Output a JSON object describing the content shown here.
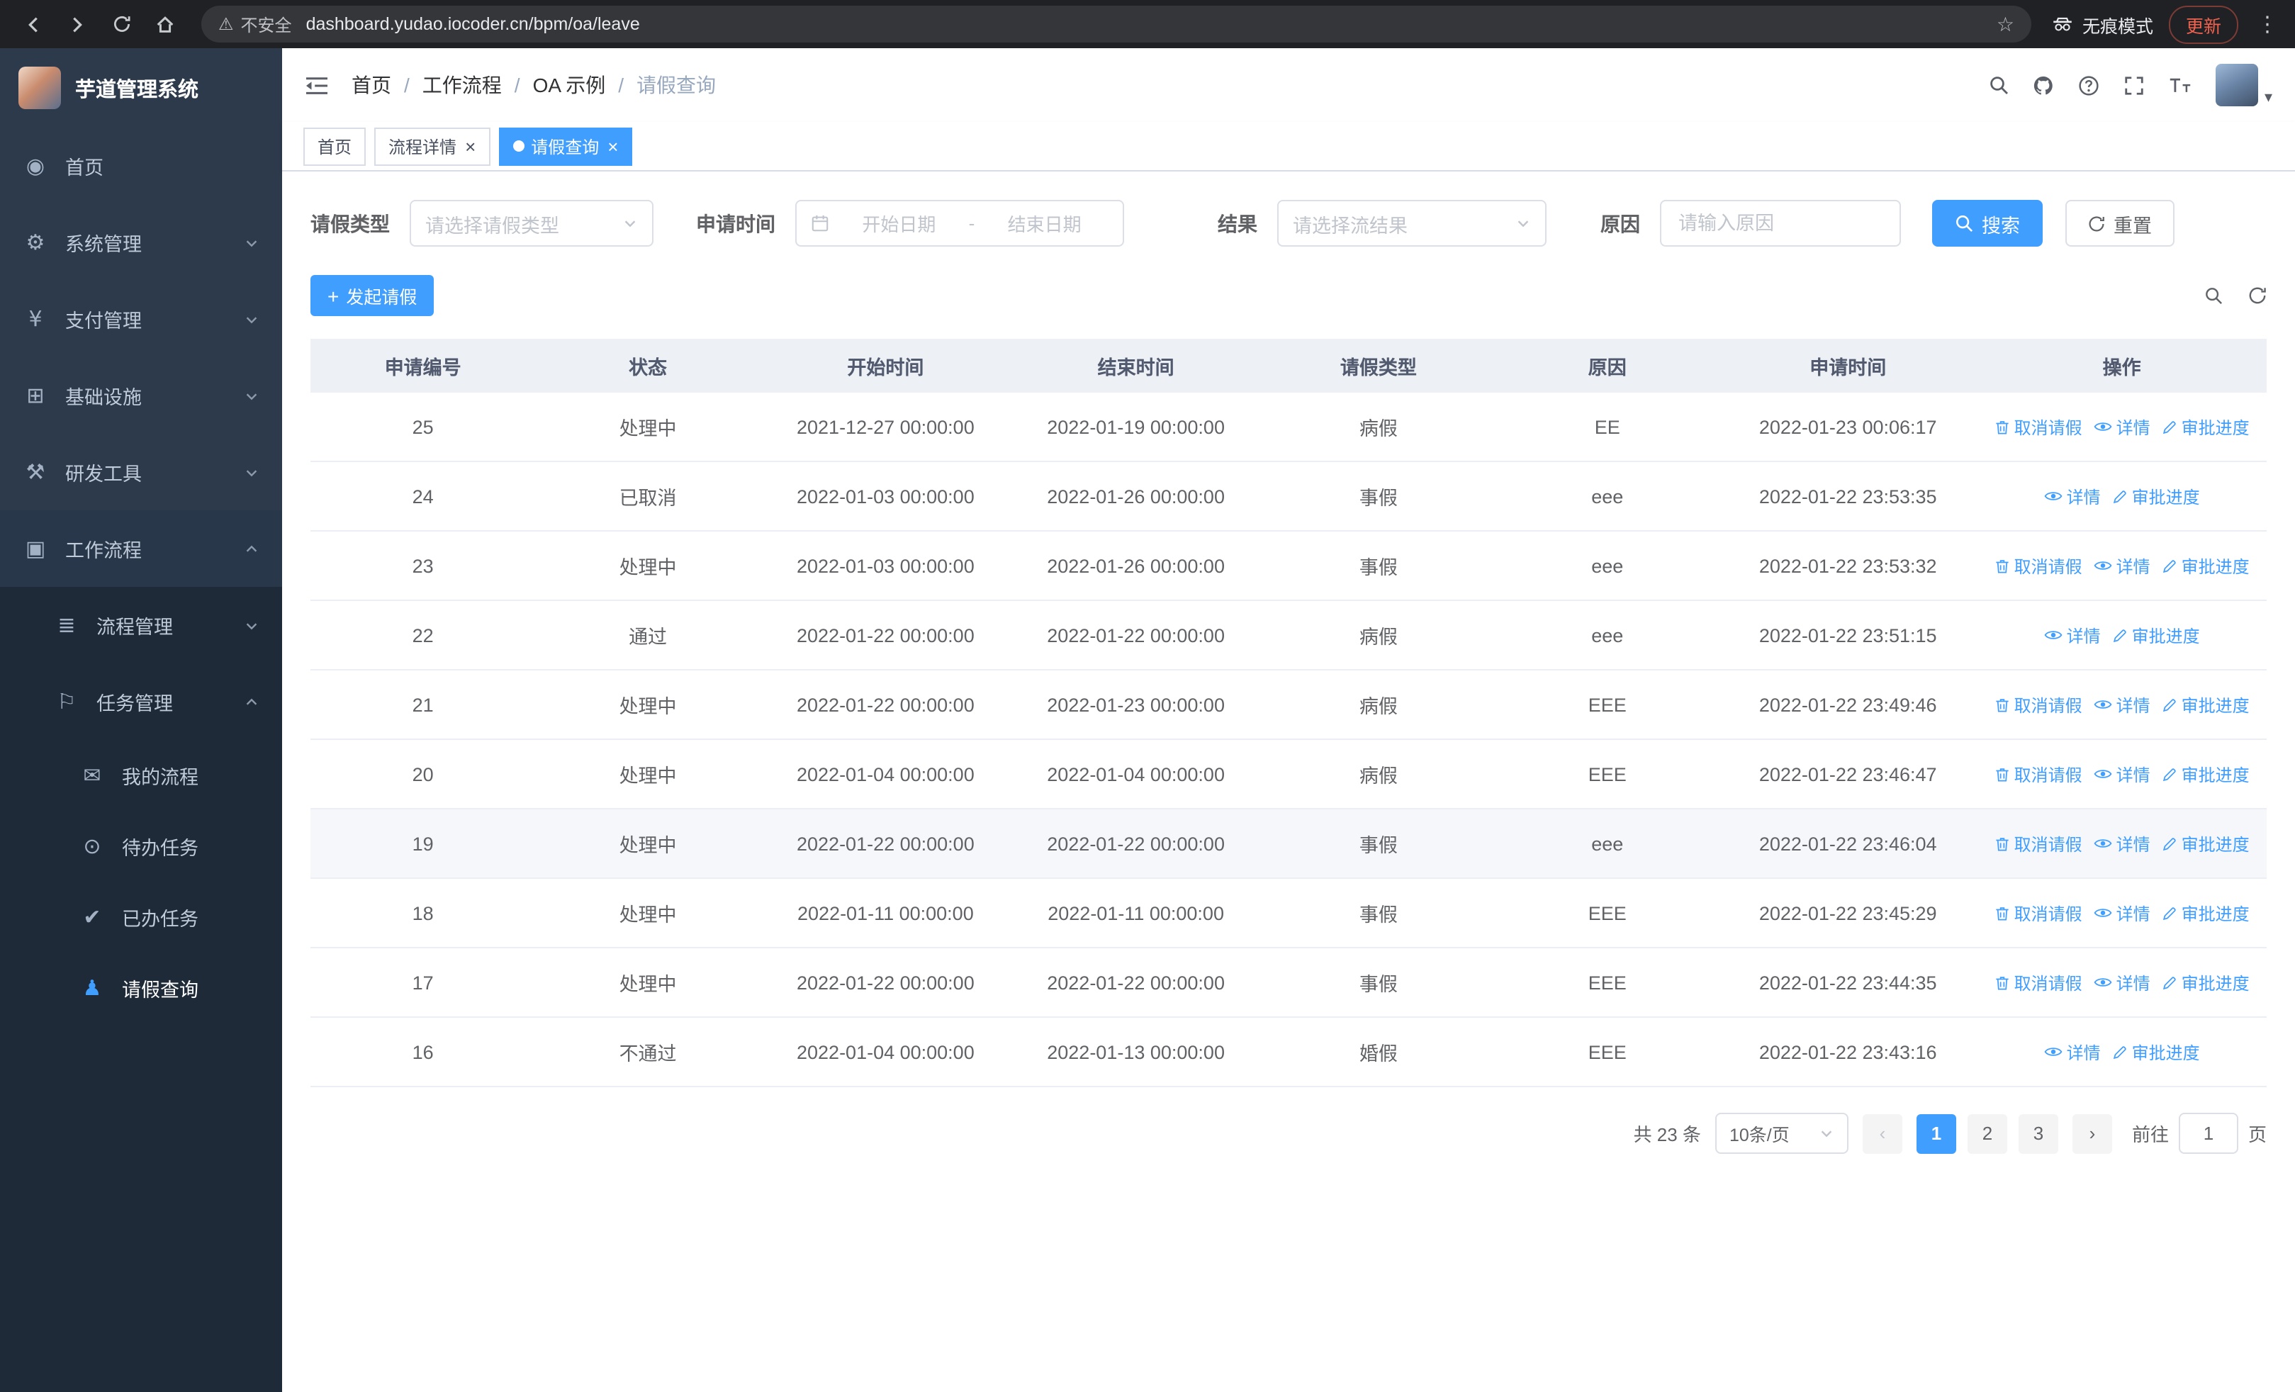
{
  "browser": {
    "security_label": "不安全",
    "url": "dashboard.yudao.iocoder.cn/bpm/oa/leave",
    "incognito_label": "无痕模式",
    "update_label": "更新"
  },
  "icons": {
    "warning_triangle": "⚠",
    "bookmark_star": "☆",
    "kebab_menu": "⋮",
    "caret_down": "▾",
    "plus": "+",
    "close": "×",
    "prev_arrow": "‹",
    "next_arrow": "›"
  },
  "colors": {
    "primary": "#409eff",
    "sidebar_bg": "#2d3a4b",
    "sidebar_sub_bg": "#1f2a38"
  },
  "sidebar": {
    "app_title": "芋道管理系统",
    "items": [
      {
        "label": "首页",
        "icon": "dashboard-icon",
        "glyph": "◉",
        "level": 1
      },
      {
        "label": "系统管理",
        "icon": "gear-icon",
        "glyph": "⚙",
        "level": 1,
        "expandable": true,
        "state": "collapsed"
      },
      {
        "label": "支付管理",
        "icon": "payment-icon",
        "glyph": "¥",
        "level": 1,
        "expandable": true,
        "state": "collapsed"
      },
      {
        "label": "基础设施",
        "icon": "infrastructure-icon",
        "glyph": "⊞",
        "level": 1,
        "expandable": true,
        "state": "collapsed"
      },
      {
        "label": "研发工具",
        "icon": "devtools-icon",
        "glyph": "⚒",
        "level": 1,
        "expandable": true,
        "state": "collapsed"
      },
      {
        "label": "工作流程",
        "icon": "workflow-icon",
        "glyph": "▣",
        "level": 1,
        "expandable": true,
        "state": "expanded",
        "hover": true
      },
      {
        "label": "流程管理",
        "icon": "process-management-icon",
        "glyph": "≣",
        "level": 2,
        "expandable": true,
        "state": "collapsed"
      },
      {
        "label": "任务管理",
        "icon": "task-management-icon",
        "glyph": "⚐",
        "level": 2,
        "expandable": true,
        "state": "expanded"
      },
      {
        "label": "我的流程",
        "icon": "my-process-icon",
        "glyph": "✉",
        "level": 3
      },
      {
        "label": "待办任务",
        "icon": "todo-task-icon",
        "glyph": "⊙",
        "level": 3
      },
      {
        "label": "已办任务",
        "icon": "done-task-icon",
        "glyph": "✔",
        "level": 3
      },
      {
        "label": "请假查询",
        "icon": "leave-query-icon",
        "glyph": "♟",
        "level": 3,
        "active": true
      }
    ]
  },
  "navbar": {
    "separator": "/",
    "breadcrumb": [
      {
        "label": "首页"
      },
      {
        "label": "工作流程",
        "sep": true
      },
      {
        "label": "OA 示例",
        "sep": true
      },
      {
        "label": "请假查询",
        "sep": true,
        "last": true
      }
    ]
  },
  "tabs": [
    {
      "label": "首页"
    },
    {
      "label": "流程详情",
      "closable": true
    },
    {
      "label": "请假查询",
      "closable": true,
      "active": true
    }
  ],
  "filters": {
    "leave_type_label": "请假类型",
    "leave_type_placeholder": "请选择请假类型",
    "apply_time_label": "申请时间",
    "start_placeholder": "开始日期",
    "range_separator": "-",
    "end_placeholder": "结束日期",
    "result_label": "结果",
    "result_placeholder": "请选择流结果",
    "reason_label": "原因",
    "reason_placeholder": "请输入原因",
    "search_label": "搜索",
    "reset_label": "重置"
  },
  "toolbar": {
    "create_label": "发起请假"
  },
  "table": {
    "columns": [
      {
        "key": "id",
        "label": "申请编号"
      },
      {
        "key": "status",
        "label": "状态"
      },
      {
        "key": "start",
        "label": "开始时间"
      },
      {
        "key": "end",
        "label": "结束时间"
      },
      {
        "key": "type",
        "label": "请假类型"
      },
      {
        "key": "reason",
        "label": "原因"
      },
      {
        "key": "apply",
        "label": "申请时间"
      },
      {
        "key": "actions",
        "label": "操作"
      }
    ],
    "action_labels": {
      "cancel": "取消请假",
      "detail": "详情",
      "progress": "审批进度"
    },
    "rows": [
      {
        "id": "25",
        "status": "处理中",
        "start": "2021-12-27 00:00:00",
        "end": "2022-01-19 00:00:00",
        "type": "病假",
        "reason": "EE",
        "apply": "2022-01-23 00:06:17",
        "can_cancel": true
      },
      {
        "id": "24",
        "status": "已取消",
        "start": "2022-01-03 00:00:00",
        "end": "2022-01-26 00:00:00",
        "type": "事假",
        "reason": "eee",
        "apply": "2022-01-22 23:53:35"
      },
      {
        "id": "23",
        "status": "处理中",
        "start": "2022-01-03 00:00:00",
        "end": "2022-01-26 00:00:00",
        "type": "事假",
        "reason": "eee",
        "apply": "2022-01-22 23:53:32",
        "can_cancel": true
      },
      {
        "id": "22",
        "status": "通过",
        "start": "2022-01-22 00:00:00",
        "end": "2022-01-22 00:00:00",
        "type": "病假",
        "reason": "eee",
        "apply": "2022-01-22 23:51:15"
      },
      {
        "id": "21",
        "status": "处理中",
        "start": "2022-01-22 00:00:00",
        "end": "2022-01-23 00:00:00",
        "type": "病假",
        "reason": "EEE",
        "apply": "2022-01-22 23:49:46",
        "can_cancel": true
      },
      {
        "id": "20",
        "status": "处理中",
        "start": "2022-01-04 00:00:00",
        "end": "2022-01-04 00:00:00",
        "type": "病假",
        "reason": "EEE",
        "apply": "2022-01-22 23:46:47",
        "can_cancel": true
      },
      {
        "id": "19",
        "status": "处理中",
        "start": "2022-01-22 00:00:00",
        "end": "2022-01-22 00:00:00",
        "type": "事假",
        "reason": "eee",
        "apply": "2022-01-22 23:46:04",
        "can_cancel": true,
        "highlight": true
      },
      {
        "id": "18",
        "status": "处理中",
        "start": "2022-01-11 00:00:00",
        "end": "2022-01-11 00:00:00",
        "type": "事假",
        "reason": "EEE",
        "apply": "2022-01-22 23:45:29",
        "can_cancel": true
      },
      {
        "id": "17",
        "status": "处理中",
        "start": "2022-01-22 00:00:00",
        "end": "2022-01-22 00:00:00",
        "type": "事假",
        "reason": "EEE",
        "apply": "2022-01-22 23:44:35",
        "can_cancel": true
      },
      {
        "id": "16",
        "status": "不通过",
        "start": "2022-01-04 00:00:00",
        "end": "2022-01-13 00:00:00",
        "type": "婚假",
        "reason": "EEE",
        "apply": "2022-01-22 23:43:16"
      }
    ]
  },
  "pagination": {
    "total_label": "共 23 条",
    "page_size_value": "10条/页",
    "pages": [
      {
        "label": "1",
        "active": true
      },
      {
        "label": "2"
      },
      {
        "label": "3"
      }
    ],
    "goto_label": "前往",
    "goto_value": "1",
    "unit_label": "页"
  }
}
